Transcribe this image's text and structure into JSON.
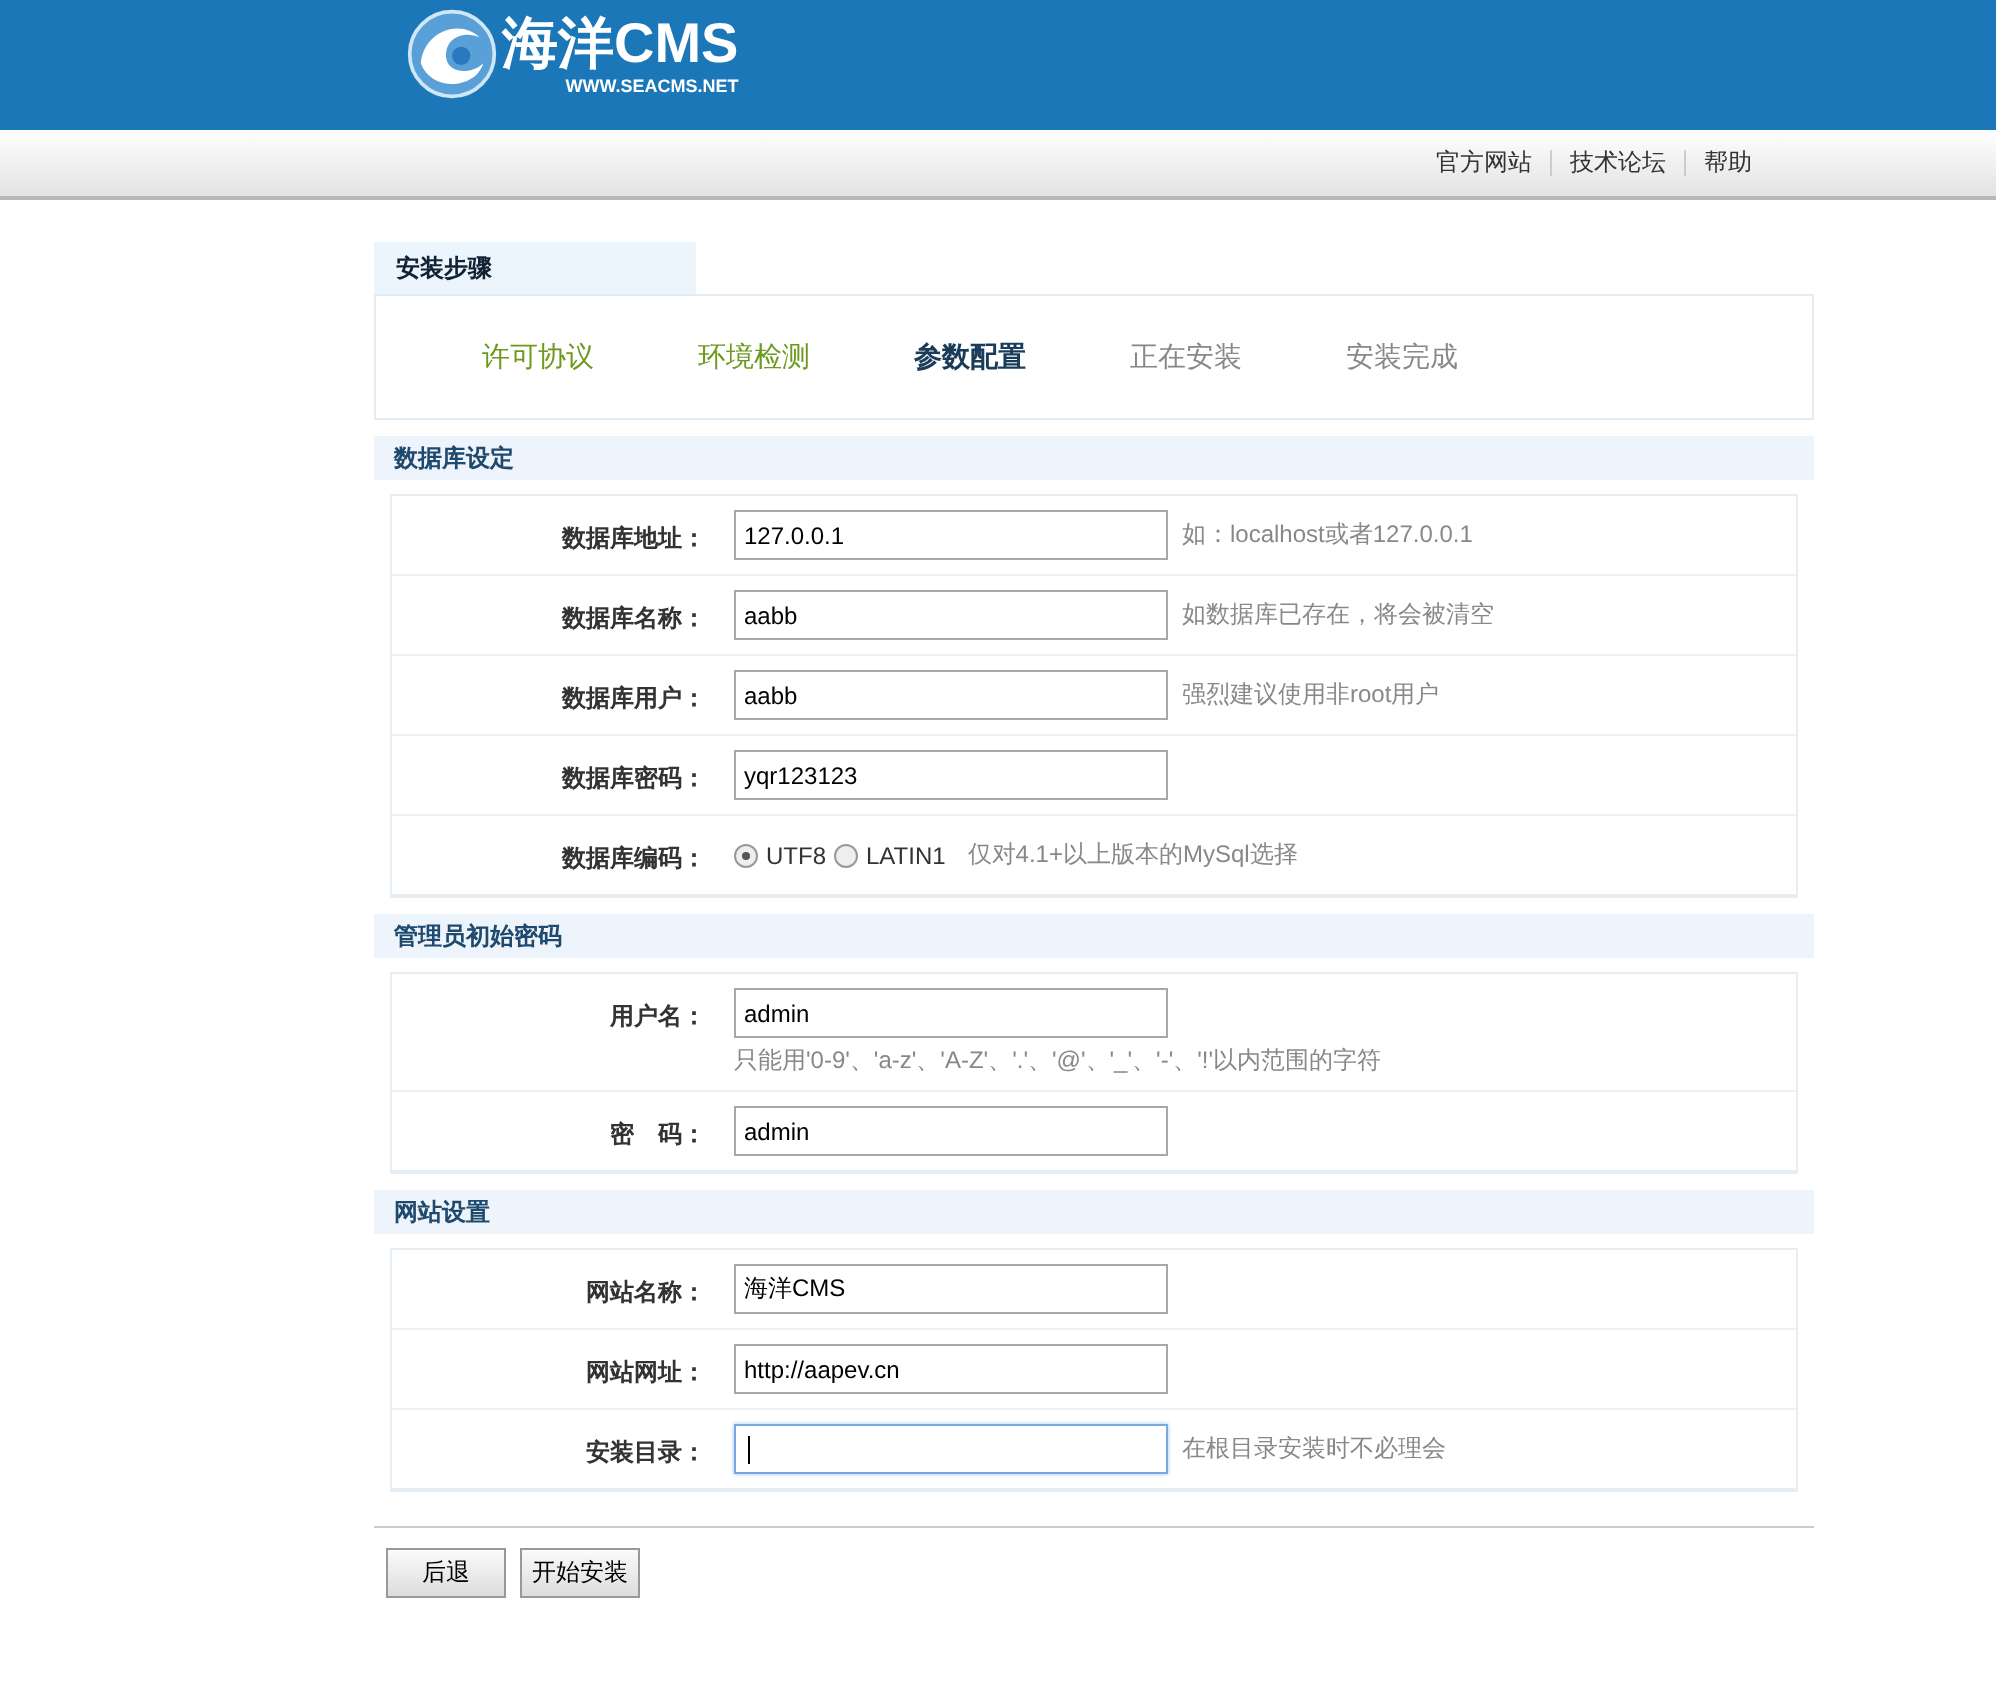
{
  "header": {
    "logo_title": "海洋CMS",
    "logo_subtitle": "WWW.SEACMS.NET"
  },
  "nav_links": [
    "官方网站",
    "技术论坛",
    "帮助"
  ],
  "steps": {
    "title": "安装步骤",
    "items": [
      {
        "label": "许可协议",
        "done": true,
        "selected": false
      },
      {
        "label": "环境检测",
        "done": true,
        "selected": false
      },
      {
        "label": "参数配置",
        "done": false,
        "selected": true
      },
      {
        "label": "正在安装",
        "done": false,
        "selected": false
      },
      {
        "label": "安装完成",
        "done": false,
        "selected": false
      }
    ]
  },
  "sections": [
    {
      "title": "数据库设定",
      "rows": [
        {
          "kind": "text",
          "label": "数据库地址：",
          "value": "127.0.0.1",
          "focused": false,
          "hint": "如：localhost或者127.0.0.1"
        },
        {
          "kind": "text",
          "label": "数据库名称：",
          "value": "aabb",
          "focused": false,
          "hint": "如数据库已存在，将会被清空"
        },
        {
          "kind": "text",
          "label": "数据库用户：",
          "value": "aabb",
          "focused": false,
          "hint": "强烈建议使用非root用户"
        },
        {
          "kind": "text",
          "label": "数据库密码：",
          "value": "yqr123123",
          "focused": false
        },
        {
          "kind": "radio",
          "label": "数据库编码：",
          "options": [
            {
              "label": "UTF8",
              "selected": true
            },
            {
              "label": "LATIN1",
              "selected": false
            }
          ],
          "hint": "仅对4.1+以上版本的MySql选择"
        }
      ]
    },
    {
      "title": "管理员初始密码",
      "rows": [
        {
          "kind": "text",
          "label": "用户名：",
          "value": "admin",
          "focused": false,
          "note": "只能用'0-9'、'a-z'、'A-Z'、'.'、'@'、'_'、'-'、'!'以内范围的字符"
        },
        {
          "kind": "text",
          "label": "密　码：",
          "value": "admin",
          "focused": false
        }
      ]
    },
    {
      "title": "网站设置",
      "rows": [
        {
          "kind": "text",
          "label": "网站名称：",
          "value": "海洋CMS",
          "focused": false
        },
        {
          "kind": "text",
          "label": "网站网址：",
          "value": "http://aapev.cn",
          "focused": false
        },
        {
          "kind": "text",
          "label": "安装目录：",
          "value": "",
          "focused": true,
          "hint": "在根目录安装时不必理会"
        }
      ]
    }
  ],
  "buttons": [
    "后退",
    "开始安装"
  ]
}
